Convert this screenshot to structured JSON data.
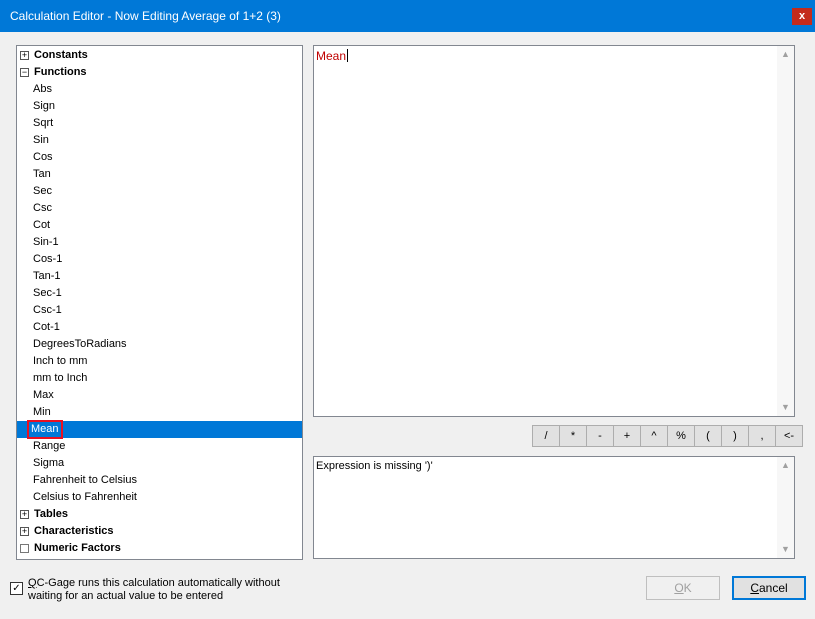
{
  "window": {
    "title": "Calculation Editor - Now Editing Average of 1+2 (3)",
    "close_label": "x"
  },
  "tree": {
    "nodes": [
      {
        "label": "Constants",
        "bold": true,
        "expander": "+"
      },
      {
        "label": "Functions",
        "bold": true,
        "expander": "−"
      },
      {
        "label": "Abs",
        "child": true
      },
      {
        "label": "Sign",
        "child": true
      },
      {
        "label": "Sqrt",
        "child": true
      },
      {
        "label": "Sin",
        "child": true
      },
      {
        "label": "Cos",
        "child": true
      },
      {
        "label": "Tan",
        "child": true
      },
      {
        "label": "Sec",
        "child": true
      },
      {
        "label": "Csc",
        "child": true
      },
      {
        "label": "Cot",
        "child": true
      },
      {
        "label": "Sin-1",
        "child": true
      },
      {
        "label": "Cos-1",
        "child": true
      },
      {
        "label": "Tan-1",
        "child": true
      },
      {
        "label": "Sec-1",
        "child": true
      },
      {
        "label": "Csc-1",
        "child": true
      },
      {
        "label": "Cot-1",
        "child": true
      },
      {
        "label": "DegreesToRadians",
        "child": true
      },
      {
        "label": "Inch to mm",
        "child": true
      },
      {
        "label": "mm to Inch",
        "child": true
      },
      {
        "label": "Max",
        "child": true
      },
      {
        "label": "Min",
        "child": true
      },
      {
        "label": "Mean",
        "child": true,
        "selected": true
      },
      {
        "label": "Range",
        "child": true
      },
      {
        "label": "Sigma",
        "child": true
      },
      {
        "label": "Fahrenheit to Celsius",
        "child": true
      },
      {
        "label": "Celsius to Fahrenheit",
        "child": true
      },
      {
        "label": "Tables",
        "bold": true,
        "expander": "+"
      },
      {
        "label": "Characteristics",
        "bold": true,
        "expander": "+"
      },
      {
        "label": "Numeric Factors",
        "bold": true,
        "expander": ""
      }
    ]
  },
  "editor": {
    "expression": "Mean"
  },
  "operators": [
    "/",
    "*",
    "-",
    "+",
    "^",
    "%",
    "(",
    ")",
    ",",
    "<-"
  ],
  "message": {
    "text": "Expression is missing ')'"
  },
  "auto_run": {
    "checked": true,
    "label_underlined": "Q",
    "label_rest": "C-Gage runs this calculation automatically without waiting for an actual value to be entered"
  },
  "buttons": {
    "ok_underlined": "O",
    "ok_rest": "K",
    "ok_enabled": false,
    "cancel_underlined": "C",
    "cancel_rest": "ancel"
  },
  "colors": {
    "title_bar": "#0078d7",
    "selection": "#0078d7",
    "close_button": "#c42b1c",
    "expression_text": "#c00000"
  }
}
